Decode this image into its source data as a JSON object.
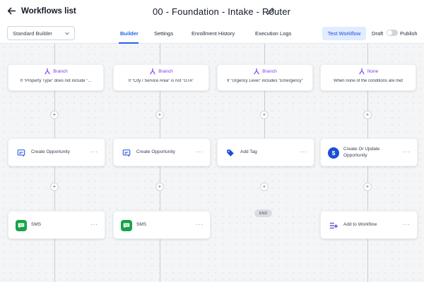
{
  "header": {
    "back_label": "Workflows list",
    "workflow_title": "00 - Foundation - Intake - Router"
  },
  "subbar": {
    "builder_select": "Standard Builder",
    "tabs": [
      {
        "label": "Builder",
        "active": true
      },
      {
        "label": "Settings",
        "active": false
      },
      {
        "label": "Enrollment History",
        "active": false
      },
      {
        "label": "Execution Logs",
        "active": false
      }
    ],
    "test_button": "Test Workflow",
    "draft_label": "Draft",
    "publish_label": "Publish",
    "publish_on": false
  },
  "canvas": {
    "branches": [
      {
        "type": "Branch",
        "condition": "If \"Property Type\" does not include \"..."
      },
      {
        "type": "Branch",
        "condition": "If \"City / Service Area\" is not \"GTA\""
      },
      {
        "type": "Branch",
        "condition": "If \"Urgency Level\" includes \"Emergency\""
      },
      {
        "type": "None",
        "condition": "When none of the conditions are met"
      }
    ],
    "actions_row1": [
      {
        "label": "Create Opportunity",
        "icon": "create-opportunity-icon"
      },
      {
        "label": "Create Opportunity",
        "icon": "create-opportunity-icon"
      },
      {
        "label": "Add Tag",
        "icon": "tag-icon"
      },
      {
        "label": "Create Or Update Opportunity",
        "icon": "dollar-icon"
      }
    ],
    "actions_row2": [
      {
        "label": "SMS",
        "icon": "sms-icon"
      },
      {
        "label": "SMS",
        "icon": "sms-icon"
      },
      {
        "label": "Add to Workflow",
        "icon": "add-to-workflow-icon"
      }
    ],
    "end_label": "END",
    "more_symbol": "···",
    "plus_symbol": "+"
  },
  "colors": {
    "accent": "#2563eb",
    "branch_purple": "#7c3aed",
    "sms_green": "#16a34a",
    "action_blue": "#1d4ed8"
  }
}
